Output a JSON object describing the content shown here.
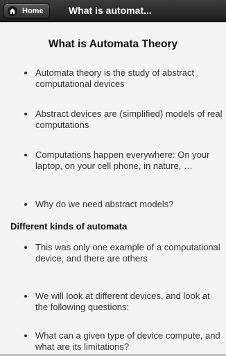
{
  "header": {
    "home_label": "Home",
    "title": "What is automat..."
  },
  "main": {
    "heading": "What is Automata Theory",
    "bullets": [
      "Automata theory is the study of abstract computational devices",
      "Abstract devices are (simplified) models of real computations",
      "Computations happen everywhere: On your laptop, on your cell phone, in nature, …",
      "Why do we need abstract models?"
    ],
    "subheading": "Different kinds of automata",
    "bullets2": [
      "This was only one example of a computational device, and there are others",
      "We will look at different devices, and look at the following questions:",
      "What can a given type of device compute, and what are its limitations?"
    ]
  },
  "icons": {
    "home": "home-icon"
  }
}
